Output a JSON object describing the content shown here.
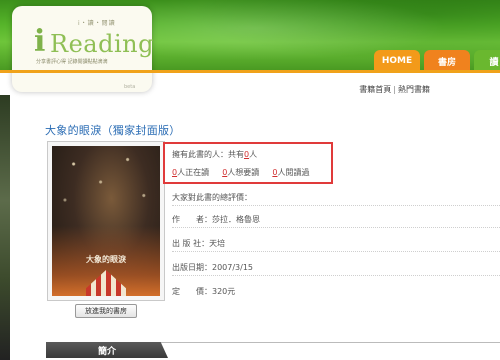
{
  "header": {
    "logo_top": "i・讀・閱讀",
    "logo_mark": "i",
    "logo_word": "Reading",
    "logo_sub": "分享書評心得 記錄閱讀點點滴滴",
    "logo_small": "beta",
    "nav": {
      "home": "HOME",
      "store": "書房",
      "more": "讀"
    }
  },
  "breadcrumb": {
    "home": "書籍首頁",
    "separator": "|",
    "popular": "熱門書籍"
  },
  "book": {
    "title": "大象的眼淚（獨家封面版）",
    "cover_title": "大象的眼淚",
    "add_shelf_label": "放進我的書房",
    "owners": {
      "prefix": "擁有此書的人：共有",
      "count": "0",
      "suffix": "人",
      "reading_count": "0",
      "reading_label": "人正在讀",
      "want_count": "0",
      "want_label": "人想要讀",
      "read_count": "0",
      "read_label": "人閱讀過"
    },
    "rating_label": "大家對此書的總評價：",
    "author_label": "作　　者：",
    "author": "莎拉．格魯恩",
    "publisher_label": "出 版 社：",
    "publisher": "天培",
    "date_label": "出版日期：",
    "date": "2007/3/15",
    "price_label": "定　　價：",
    "price": "320元"
  },
  "section": {
    "intro": "簡介"
  },
  "colors": {
    "title_blue": "#2a6cb4",
    "highlight_red": "#e03a3a",
    "nav_orange": "#f39a1a",
    "nav_green": "#6ab82f"
  }
}
